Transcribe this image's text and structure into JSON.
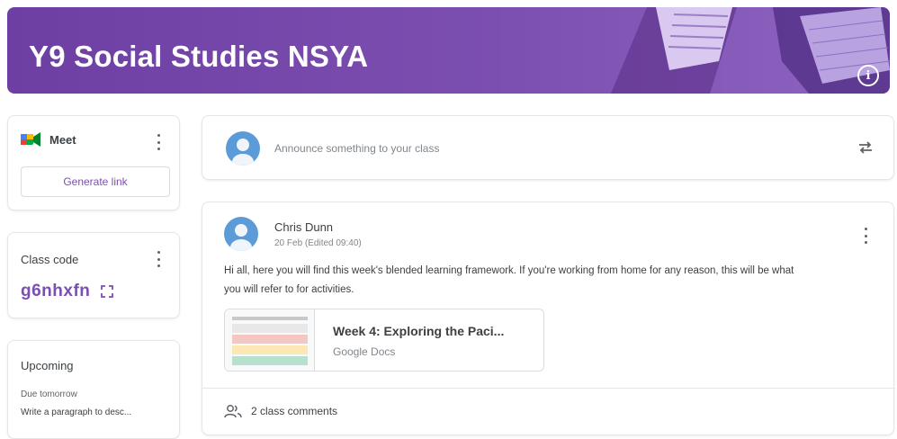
{
  "banner": {
    "title": "Y9 Social Studies NSYA",
    "info_icon": "info-icon",
    "info_glyph": "i",
    "gradient": [
      "#6e3fa3",
      "#8d63c0"
    ]
  },
  "meet": {
    "label": "Meet",
    "icon": "google-meet-icon",
    "generate_label": "Generate link"
  },
  "class_code": {
    "label": "Class code",
    "code": "g6nhxfn",
    "fullscreen_icon": "fullscreen-icon"
  },
  "upcoming": {
    "label": "Upcoming",
    "due_label": "Due tomorrow",
    "item": "Write a paragraph to desc..."
  },
  "announce": {
    "placeholder": "Announce something to your class",
    "repost_icon": "repost-icon"
  },
  "post": {
    "author": "Chris Dunn",
    "date": "20 Feb (Edited 09:40)",
    "body_line1": "Hi all, here you will find this week's blended learning framework. If you're working from home for any reason, this will be what",
    "body_line2": "you will refer to for activities.",
    "attachment_title": "Week 4: Exploring the Paci...",
    "attachment_type": "Google Docs",
    "comments": "2 class comments",
    "comments_icon": "people-icon"
  },
  "colors": {
    "accent": "#7b4fb0",
    "avatar": "#5b9bd8",
    "banner": "#6e3fa3"
  }
}
